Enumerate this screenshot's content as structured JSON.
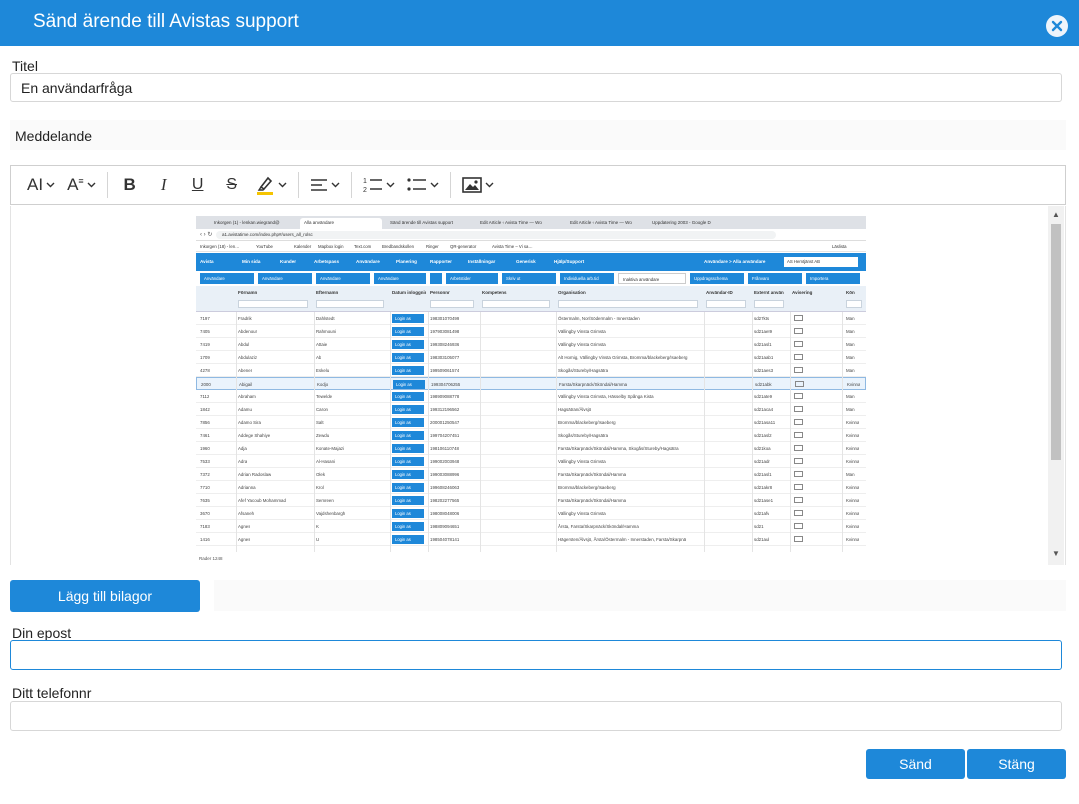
{
  "dialog": {
    "title": "Sänd ärende till Avistas support"
  },
  "form": {
    "title_label": "Titel",
    "title_value": "En användarfråga",
    "message_label": "Meddelande",
    "attach_button": "Lägg till bilagor",
    "email_label": "Din epost",
    "email_value": "",
    "phone_label": "Ditt telefonnr",
    "phone_value": "",
    "send_button": "Sänd",
    "close_button": "Stäng"
  },
  "toolbar": {
    "icons": [
      "font-size-icon",
      "font-style-icon",
      "bold-icon",
      "italic-icon",
      "underline-icon",
      "strikethrough-icon",
      "highlight-icon",
      "align-icon",
      "ordered-list-icon",
      "bullet-list-icon",
      "image-icon"
    ],
    "font_size_glyph": "AI",
    "font_style_glyph": "A",
    "bold_glyph": "B",
    "italic_glyph": "I",
    "underline_glyph": "U",
    "strike_glyph": "S"
  },
  "embedded_screenshot": {
    "tabs": [
      "Inkorgen (1) - lenkan.wiegrand@",
      "Alla användare",
      "Sänd ärende till Avistas support",
      "Edit Article ‹ Avista Time — Wo",
      "Edit Article ‹ Avista Time — Wo",
      "Uppdatering 2003 - Google D"
    ],
    "url": "a1.avistatime.com/index.php#/users_all_rolsc",
    "bookmarks": [
      "Inkorgen (18) - len…",
      "YouTube",
      "Kalender",
      "Mapbox login",
      "Text.com",
      "Bredbandskollen",
      "Ringer",
      "QR-generator",
      "Avista Time – Vi sa…"
    ],
    "bookmark_right": "Läslista",
    "nav": [
      "Avista",
      "Min sida",
      "Kunder",
      "Arbetspass",
      "Användare",
      "Planering",
      "Rapporter",
      "Inställningar",
      "Generisk",
      "Hjälp/Support"
    ],
    "nav_breadcrumb": "Användare > Alla användare",
    "nav_company": "AS Hemtjänst AB",
    "actions": [
      "Användare",
      "Användare",
      "Användare",
      "Användare",
      "",
      "Arbetstider",
      "Skriv ut",
      "Individuella arb.tid",
      "Inaktiva användare",
      "Uppdragsschema",
      "Frånvaro",
      "Importera"
    ],
    "columns": [
      "",
      "Förnamn",
      "Efternamn",
      "Datum inloggning",
      "Personnr",
      "Kompetens",
      "Organisation",
      "Användar-ID",
      "Externt använ",
      "Avisering",
      "Kön"
    ],
    "rows": [
      [
        "7197",
        "Fradrik",
        "Dahlstedt",
        "198301070499",
        "Östermalm, Nor/Södermalm - Innerstaden",
        "sd27kts",
        "Man"
      ],
      [
        "7405",
        "Abdenour",
        "Rahmouni",
        "197903081498",
        "Vällingby Vinsta Grimsta",
        "sd21aeI9",
        "Man"
      ],
      [
        "7419",
        "Abdul",
        "Attaie",
        "199308246936",
        "Vällingby Vinsta Grimsta",
        "sd21asl1",
        "Man"
      ],
      [
        "1709",
        "Abdulaziz",
        "Ab",
        "198303105077",
        "Alt Hornig, Vällingby Vinsta Grimsta, Bromma/blackeberg/Isaeberg",
        "sd21aab1",
        "Man"
      ],
      [
        "4278",
        "Abener",
        "Eskelu",
        "199509061574",
        "Skogås/Stureby/Hagsätra",
        "sd21aes3",
        "Man"
      ],
      [
        "2000",
        "Abigail",
        "Kodjo",
        "199304706255",
        "Farsta/Skarpnäck/Sköndal/Hamma",
        "sd21abk",
        "Kvinna"
      ],
      [
        "7112",
        "Abraham",
        "Tewelde",
        "198909088778",
        "Vällingby Vinsta Grimsta, Hässelby Spånga Kista",
        "sd21ate9",
        "Man"
      ],
      [
        "1842",
        "Adamu",
        "Caron",
        "199312196562",
        "Hagsätran/Älvsjö",
        "sd21aca4",
        "Man"
      ],
      [
        "7856",
        "Adamo Sira",
        "Salt",
        "200001250547",
        "Bromma/blackeberg/Isaeberg",
        "sd21asa11",
        "Kvinna"
      ],
      [
        "7461",
        "Addege Shahiye",
        "Zewdu",
        "199704207451",
        "Skogås/Stureby/Hagsätra",
        "sd21asl2",
        "Kvinna"
      ],
      [
        "1960",
        "Adja",
        "Konate-Majazi",
        "198106110748",
        "Farsta/Skarpnäck/Sköndal/Hamma, Skogås/Stureby/Hagsätra",
        "sd21koa",
        "Kvinna"
      ],
      [
        "7533",
        "Adra",
        "Al-Hasani",
        "199002003948",
        "Vällingby Vinsta Grimsta",
        "sd21adr",
        "Kvinna"
      ],
      [
        "7372",
        "Adrian Radoslaw",
        "Olek",
        "199003088996",
        "Farsta/Skarpnäck/Sköndal/Hamma",
        "sd21asl1",
        "Man"
      ],
      [
        "7710",
        "Adrianna",
        "Krol",
        "199608246063",
        "Bromma/blackeberg/Isaeberg",
        "sd21akr8",
        "Kvinna"
      ],
      [
        "7635",
        "Afef Yacoub Mohammad",
        "Semreen",
        "198202277565",
        "Farsta/Skarpnäck/Sköndal/Hamma",
        "sd21ase1",
        "Kvinna"
      ],
      [
        "3670",
        "Afsaneh",
        "Vajdshenbargh",
        "198008048006",
        "Vällingby Vinsta Grimsta",
        "sd21afv",
        "Kvinna"
      ],
      [
        "7183",
        "Agnes",
        "K",
        "198809094651",
        "Årsta, Farsta/Skarpnäck/Sköndal/Hamma",
        "sd21",
        "Kvinna"
      ],
      [
        "1416",
        "Agnes",
        "U",
        "198504078141",
        "Hägersten/Älvsjö, Årsta/Östermalm - Innerstaden, Farsta/Skarpnä",
        "sd21aul",
        "Kvinna"
      ]
    ],
    "login_label": "Login as",
    "footer": "Rader 1248"
  }
}
